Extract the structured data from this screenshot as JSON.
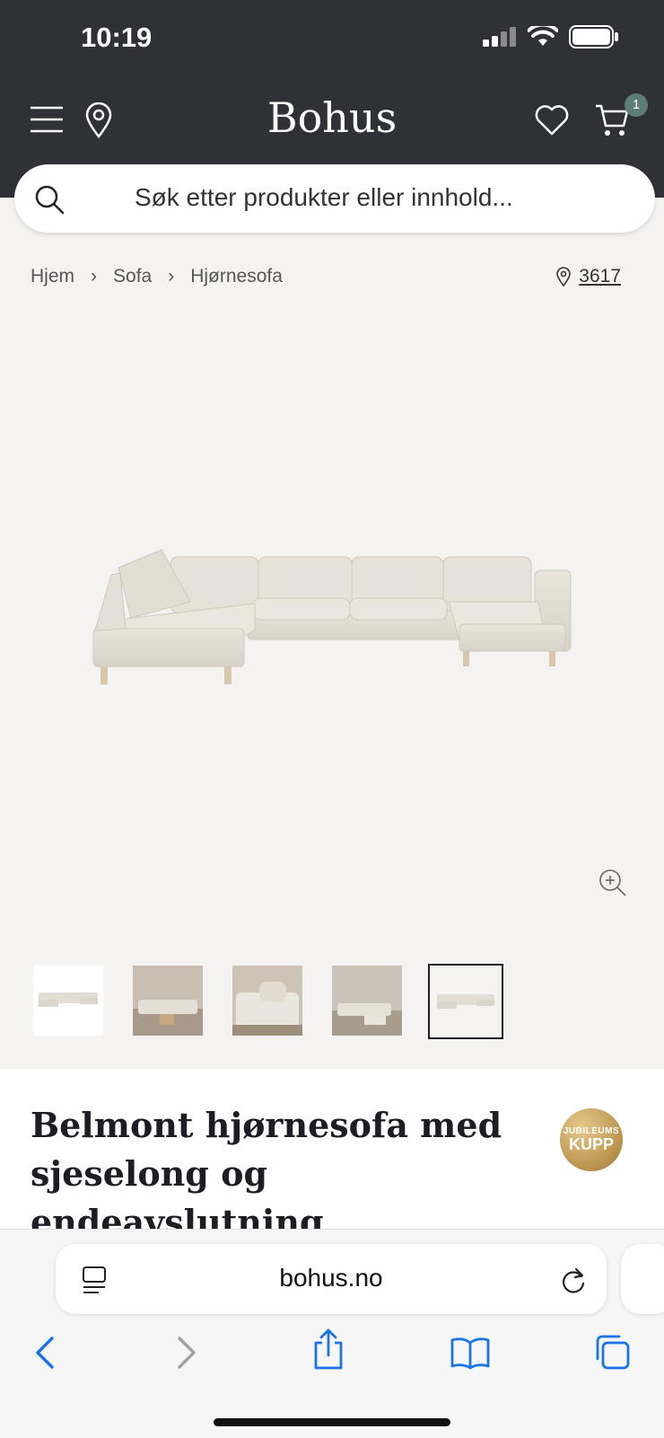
{
  "status": {
    "time": "10:19"
  },
  "header": {
    "logo": "Bohus",
    "cart_count": "1"
  },
  "search": {
    "placeholder": "Søk etter produkter eller innhold..."
  },
  "breadcrumb": [
    "Hjem",
    "Sofa",
    "Hjørnesofa"
  ],
  "store": {
    "number": "3617"
  },
  "product": {
    "title": "Belmont hjørnesofa med sjeselong og endeavslutning",
    "badge_line1": "JUBILEUMS",
    "badge_line2": "KUPP",
    "thumbnails": 5,
    "selected_thumbnail": 5
  },
  "browser": {
    "url": "bohus.no"
  },
  "colors": {
    "header_bg": "#303037",
    "badge_green": "#5e7d77",
    "page_bg": "#f5f3f2",
    "safari_blue": "#1a73e8"
  }
}
